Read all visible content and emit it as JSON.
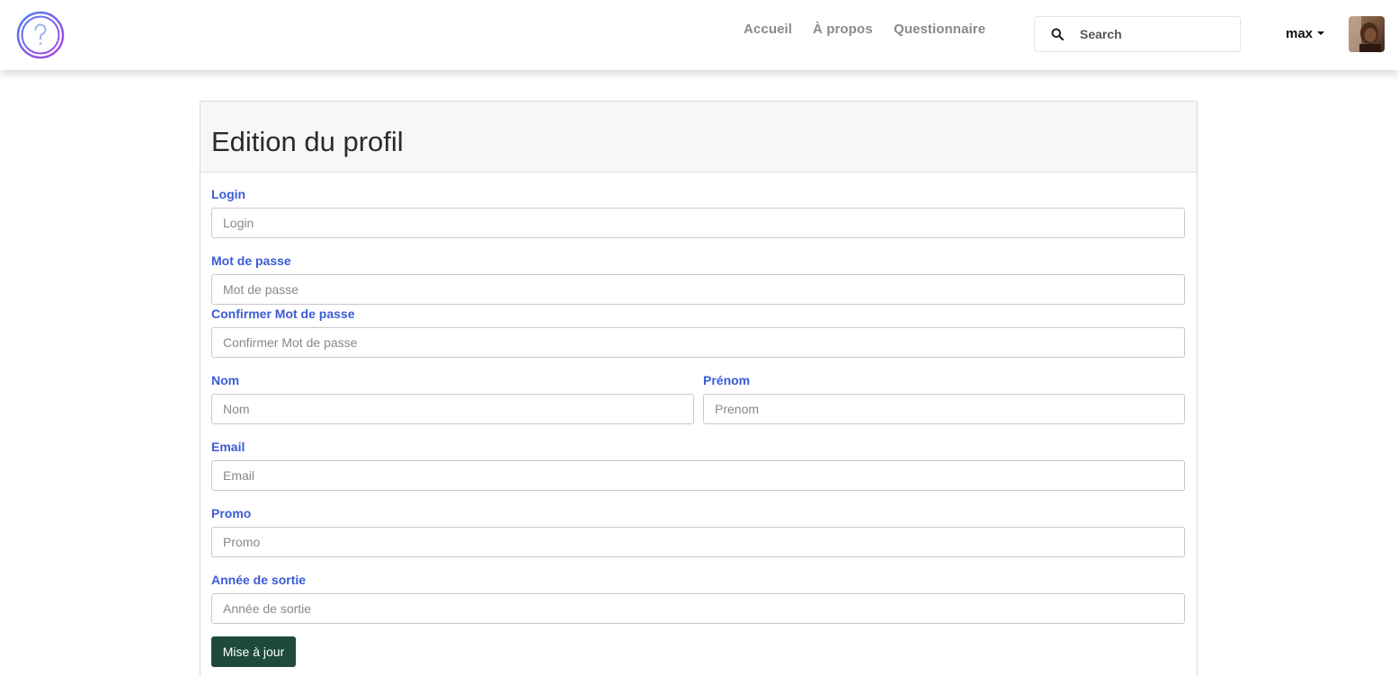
{
  "nav": {
    "links": [
      "Accueil",
      "À propos",
      "Questionnaire"
    ],
    "search_placeholder": "Search",
    "user_label": "max"
  },
  "form": {
    "title": "Edition du profil",
    "login": {
      "label": "Login",
      "placeholder": "Login"
    },
    "password": {
      "label": "Mot de passe",
      "placeholder": "Mot de passe"
    },
    "confirm_password": {
      "label": "Confirmer Mot de passe",
      "placeholder": "Confirmer Mot de passe"
    },
    "last_name": {
      "label": "Nom",
      "placeholder": "Nom"
    },
    "first_name": {
      "label": "Prénom",
      "placeholder": "Prenom"
    },
    "email": {
      "label": "Email",
      "placeholder": "Email"
    },
    "promo": {
      "label": "Promo",
      "placeholder": "Promo"
    },
    "graduation_year": {
      "label": "Année de sortie",
      "placeholder": "Année de sortie"
    },
    "submit_label": "Mise à jour"
  },
  "colors": {
    "label": "#3b5bd6",
    "button": "#1e4a3b",
    "header_bg": "#f7f7f7"
  },
  "icons": {
    "logo": "question-mark-circle-logo",
    "search": "magnifier",
    "user_caret": "caret-down",
    "avatar": "user-photo"
  }
}
